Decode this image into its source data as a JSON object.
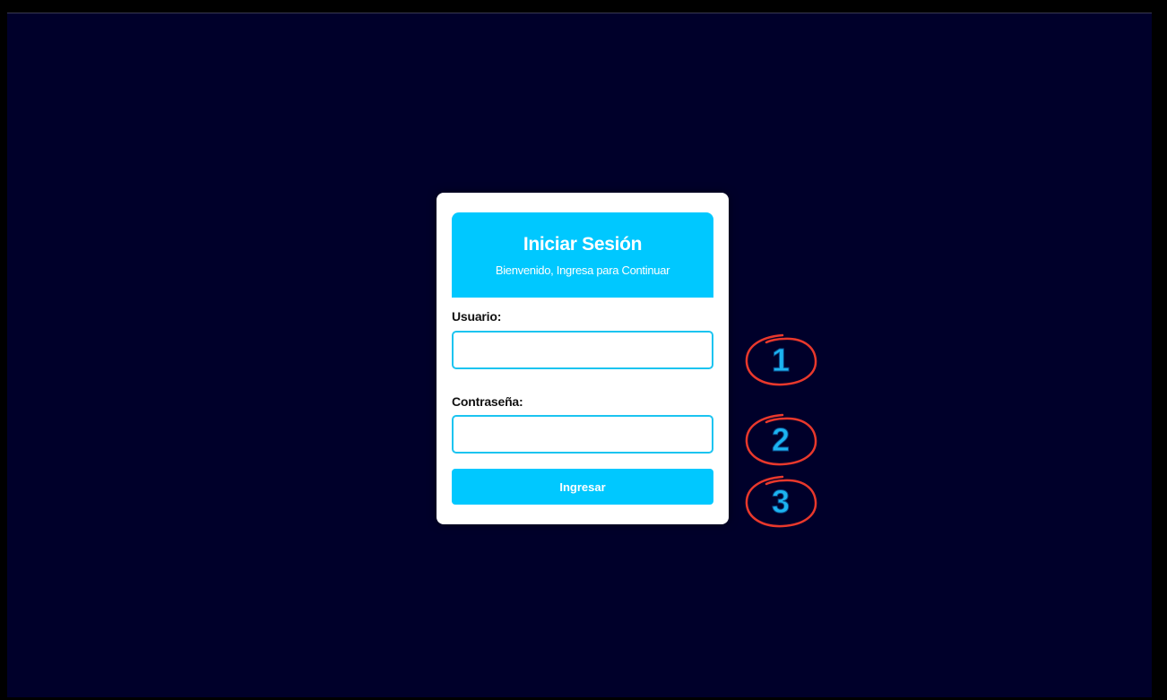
{
  "login": {
    "title": "Iniciar Sesión",
    "subtitle": "Bienvenido, Ingresa para Continuar",
    "user_label": "Usuario:",
    "user_value": "",
    "password_label": "Contraseña:",
    "password_value": "",
    "submit_label": "Ingresar"
  },
  "annotations": [
    {
      "number": "1"
    },
    {
      "number": "2"
    },
    {
      "number": "3"
    }
  ],
  "colors": {
    "background": "#00002a",
    "accent": "#00c8ff",
    "annotation_circle": "#e8382c",
    "annotation_number": "#1cb4f0"
  }
}
